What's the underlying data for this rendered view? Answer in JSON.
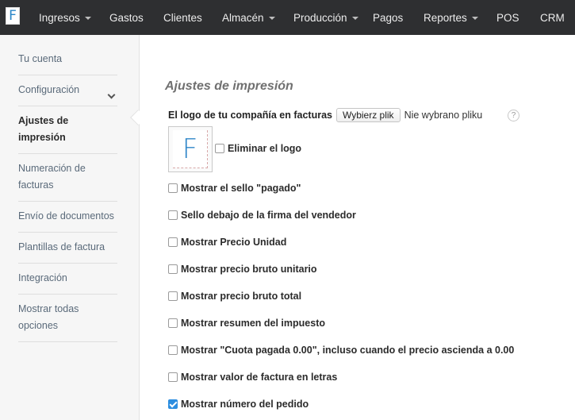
{
  "navbar": {
    "logo_letter": "F",
    "items": [
      {
        "label": "Ingresos",
        "dropdown": true
      },
      {
        "label": "Gastos",
        "dropdown": false
      },
      {
        "label": "Clientes",
        "dropdown": false
      },
      {
        "label": "Almacén",
        "dropdown": true
      },
      {
        "label": "Producción",
        "dropdown": true
      },
      {
        "label": "Pagos",
        "dropdown": false
      },
      {
        "label": "Reportes",
        "dropdown": true
      },
      {
        "label": "POS",
        "dropdown": false
      },
      {
        "label": "CRM",
        "dropdown": false
      }
    ]
  },
  "sidebar": {
    "items": [
      {
        "label": "Tu cuenta"
      },
      {
        "label": "Configuración",
        "icon": "chevron-down-icon"
      },
      {
        "label": "Ajustes de impresión",
        "active": true
      },
      {
        "label": "Numeración de facturas"
      },
      {
        "label": "Envío de documentos"
      },
      {
        "label": "Plantillas de factura"
      },
      {
        "label": "Integración"
      },
      {
        "label": "Mostrar todas opciones"
      }
    ]
  },
  "main": {
    "title": "Ajustes de impresión",
    "logo_label": "El logo de tu compañía en facturas",
    "file_button": "Wybierz plik",
    "file_status": "Nie wybrano pliku",
    "help_icon": "?",
    "logo_preview_letter": "F",
    "remove_logo_label": "Eliminar el logo",
    "options": [
      {
        "label": "Mostrar el sello \"pagado\"",
        "checked": false
      },
      {
        "label": "Sello debajo de la firma del vendedor",
        "checked": false
      },
      {
        "label": "Mostrar Precio Unidad",
        "checked": false
      },
      {
        "label": "Mostrar precio bruto unitario",
        "checked": false
      },
      {
        "label": "Mostrar precio bruto total",
        "checked": false
      },
      {
        "label": "Mostrar resumen del impuesto",
        "checked": false
      },
      {
        "label": "Mostrar \"Cuota pagada 0.00\", incluso cuando el precio ascienda a 0.00",
        "checked": false
      },
      {
        "label": "Mostrar valor de factura en letras",
        "checked": false
      },
      {
        "label": "Mostrar número del pedido",
        "checked": true
      }
    ]
  },
  "colors": {
    "navbar_bg": "#2e2f31",
    "accent": "#2d8ee0",
    "sidebar_bg": "#f6f6f6"
  }
}
